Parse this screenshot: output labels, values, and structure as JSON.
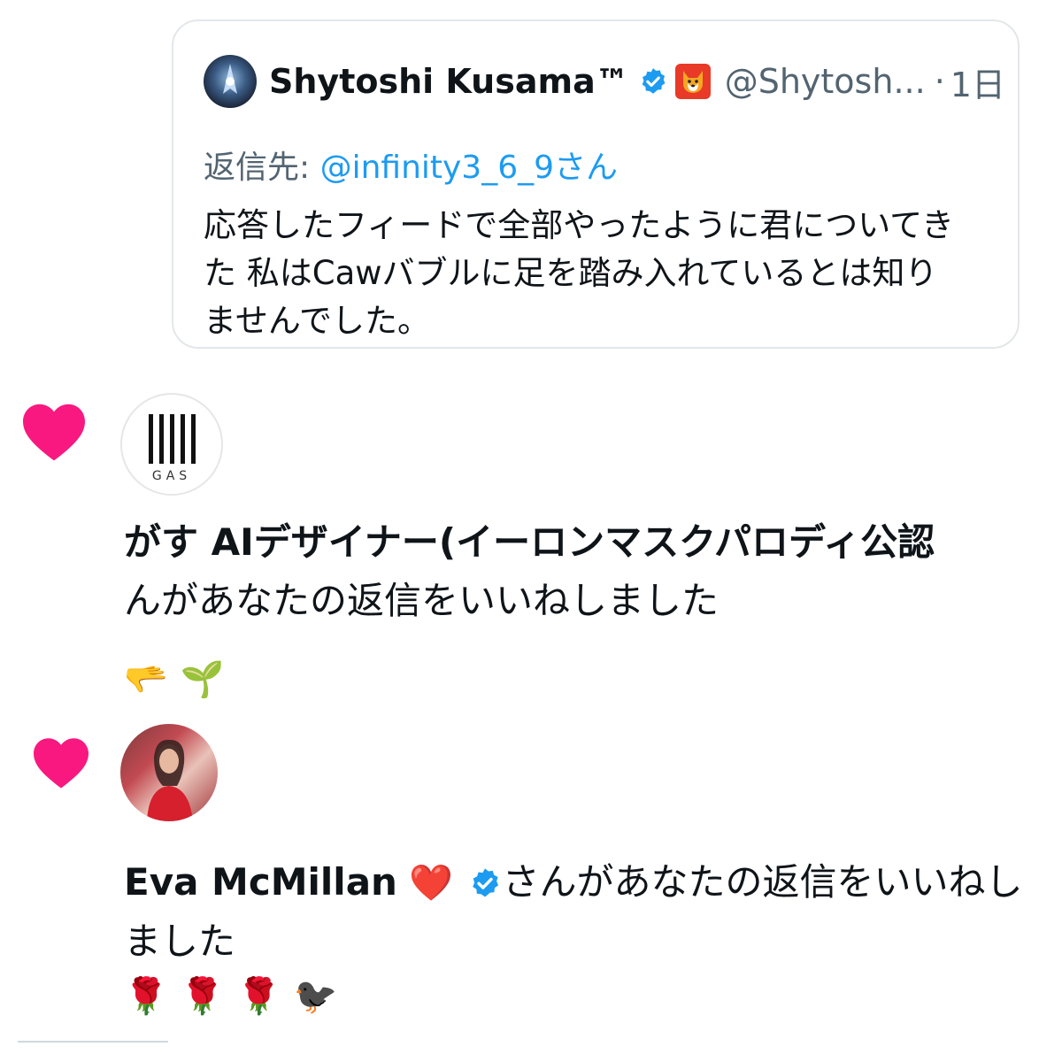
{
  "quote": {
    "author_name": "Shytoshi Kusama™",
    "handle": "@Shytosh...",
    "separator": "·",
    "time": "1日",
    "reply_prefix": "返信先: ",
    "reply_mention": "@infinity3_6_9",
    "reply_suffix": "さん",
    "text_lines": [
      "応答したフィードで全部やったように君についてき",
      "た 私はCawバブルに足を踏み入れているとは知り",
      "ませんでした。"
    ]
  },
  "notifications": [
    {
      "avatar_label": "GAS",
      "line1": "がす AIデザイナー(イーロンマスクパロディ公認",
      "line2": "んがあなたの返信をいいねしました",
      "emojis": [
        "🫳",
        "🌱"
      ]
    },
    {
      "name": "Eva McMillan",
      "name_emoji": "❤️",
      "line1_suffix": "さんがあなたの返信をいいねし",
      "line2": "ました",
      "emojis": [
        "🌹",
        "🌹",
        "🌹",
        "🐦‍⬛"
      ]
    }
  ],
  "colors": {
    "heart": "#f91880",
    "verified": "#1d9bf0",
    "secondary_text": "#536471",
    "link": "#1d9bf0"
  }
}
